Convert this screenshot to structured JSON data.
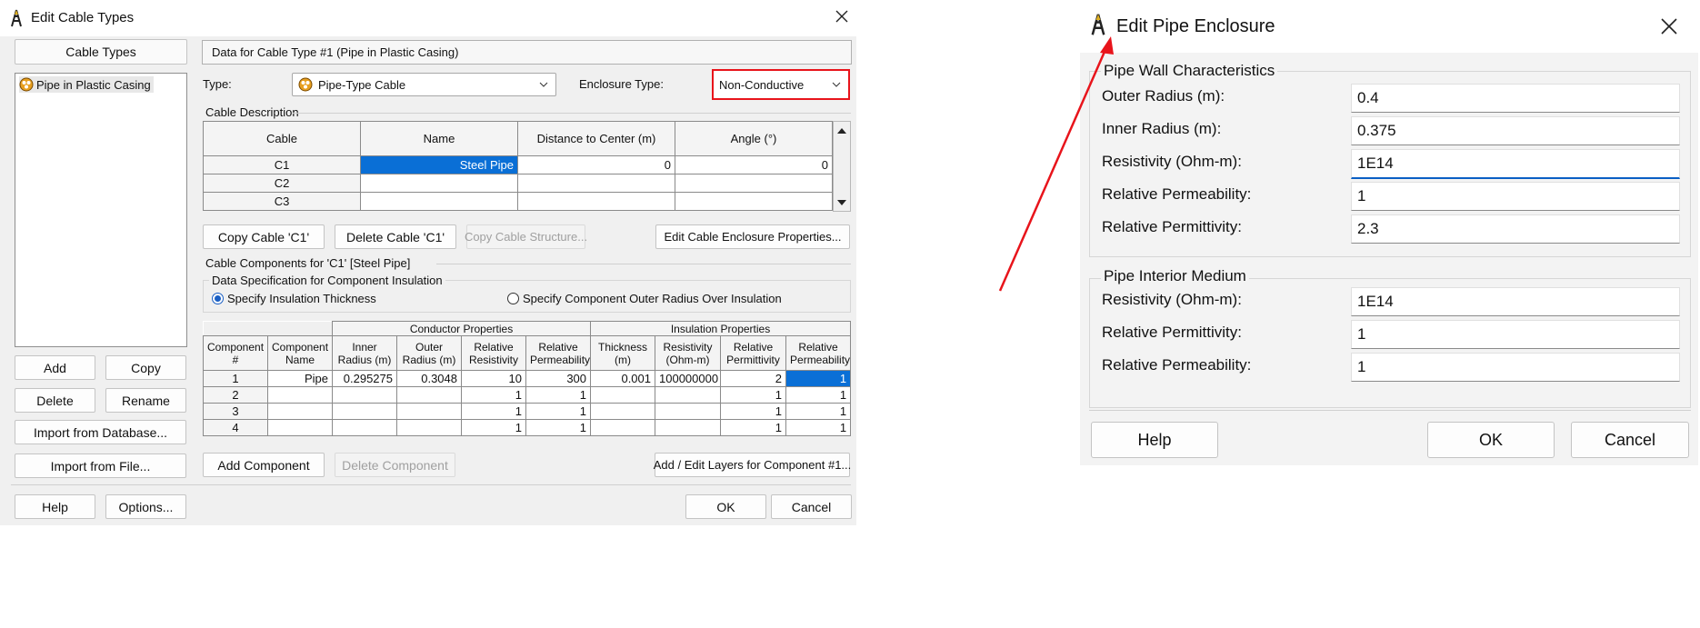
{
  "cable_dialog": {
    "title": "Edit Cable Types",
    "cable_types_label": "Cable Types",
    "cable_types_items": [
      "Pipe in Plastic Casing"
    ],
    "buttons": {
      "add": "Add",
      "copy": "Copy",
      "delete": "Delete",
      "rename": "Rename",
      "import_db": "Import from Database...",
      "import_file": "Import from File...",
      "help": "Help",
      "options": "Options...",
      "ok": "OK",
      "cancel": "Cancel"
    },
    "data_header": "Data for Cable Type #1 (Pipe in Plastic Casing)",
    "type_label": "Type:",
    "type_value": "Pipe-Type Cable",
    "enclosure_label": "Enclosure Type:",
    "enclosure_value": "Non-Conductive",
    "cable_description_label": "Cable Description",
    "cable_table": {
      "headers": [
        "Cable",
        "Name",
        "Distance to Center (m)",
        "Angle (°)"
      ],
      "rows": [
        [
          "C1",
          "Steel Pipe",
          "0",
          "0"
        ],
        [
          "C2",
          "",
          "",
          ""
        ],
        [
          "C3",
          "",
          "",
          ""
        ]
      ]
    },
    "cable_buttons": {
      "copy_cable": "Copy Cable 'C1'",
      "delete_cable": "Delete Cable 'C1'",
      "copy_structure": "Copy Cable Structure...",
      "edit_enclosure": "Edit Cable Enclosure Properties..."
    },
    "components_label": "Cable Components for 'C1' [Steel Pipe]",
    "spec_label": "Data Specification for Component Insulation",
    "radio_thickness": "Specify Insulation Thickness",
    "radio_outer": "Specify Component Outer Radius Over Insulation",
    "comp_table": {
      "group_conductor": "Conductor Properties",
      "group_insulation": "Insulation Properties",
      "headers": [
        "Component #",
        "Component Name",
        "Inner Radius (m)",
        "Outer Radius (m)",
        "Relative Resistivity",
        "Relative Permeability",
        "Thickness (m)",
        "Resistivity (Ohm-m)",
        "Relative Permittivity",
        "Relative Permeability"
      ],
      "rows": [
        [
          "1",
          "Pipe",
          "0.295275",
          "0.3048",
          "10",
          "300",
          "0.001",
          "100000000",
          "2",
          "1"
        ],
        [
          "2",
          "",
          "",
          "",
          "1",
          "1",
          "",
          "",
          "1",
          "1"
        ],
        [
          "3",
          "",
          "",
          "",
          "1",
          "1",
          "",
          "",
          "1",
          "1"
        ],
        [
          "4",
          "",
          "",
          "",
          "1",
          "1",
          "",
          "",
          "1",
          "1"
        ]
      ]
    },
    "comp_buttons": {
      "add_component": "Add Component",
      "delete_component": "Delete Component",
      "add_layers": "Add / Edit Layers for Component #1..."
    }
  },
  "pipe_dialog": {
    "title": "Edit Pipe Enclosure",
    "wall_group": "Pipe Wall Characteristics",
    "wall_fields": [
      {
        "label": "Outer Radius (m):",
        "value": "0.4"
      },
      {
        "label": "Inner Radius (m):",
        "value": "0.375"
      },
      {
        "label": "Resistivity (Ohm-m):",
        "value": "1E14"
      },
      {
        "label": "Relative Permeability:",
        "value": "1"
      },
      {
        "label": "Relative Permittivity:",
        "value": "2.3"
      }
    ],
    "interior_group": "Pipe Interior Medium",
    "interior_fields": [
      {
        "label": "Resistivity (Ohm-m):",
        "value": "1E14"
      },
      {
        "label": "Relative Permittivity:",
        "value": "1"
      },
      {
        "label": "Relative Permeability:",
        "value": "1"
      }
    ],
    "buttons": {
      "help": "Help",
      "ok": "OK",
      "cancel": "Cancel"
    }
  },
  "colors": {
    "highlight_box": "#e8141b",
    "selection": "#0a6fd6",
    "arrow": "#e8141b"
  }
}
